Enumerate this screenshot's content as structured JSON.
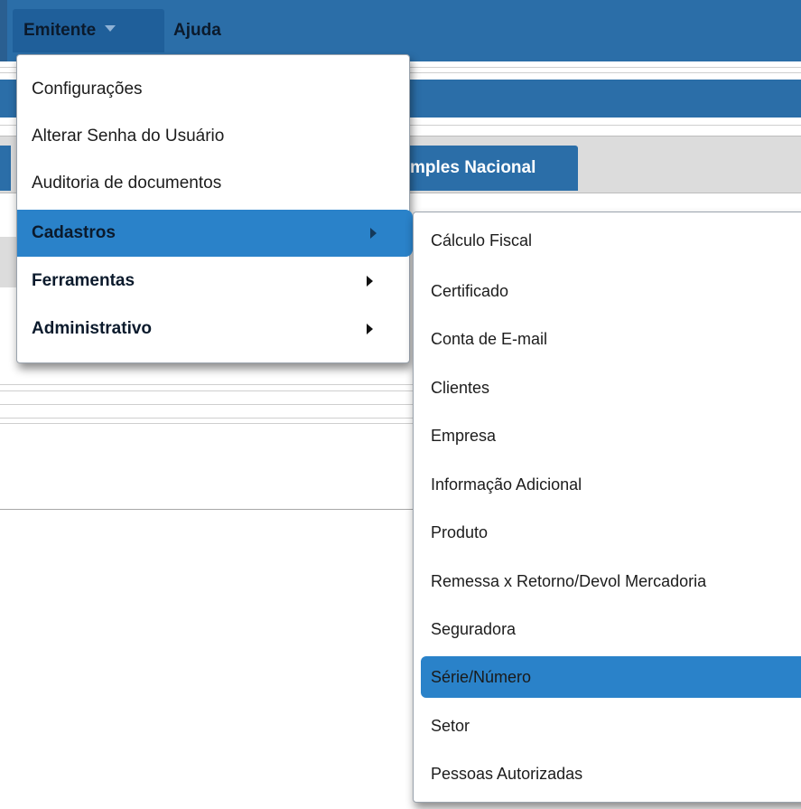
{
  "menubar": {
    "emitente_label": "Emitente",
    "ajuda_label": "Ajuda"
  },
  "background": {
    "tab_label": "mples Nacional"
  },
  "emitente_menu": {
    "items": [
      {
        "label": "Configurações"
      },
      {
        "label": "Alterar Senha do Usuário"
      },
      {
        "label": "Auditoria de documentos"
      },
      {
        "label": "Cadastros"
      },
      {
        "label": "Ferramentas"
      },
      {
        "label": "Administrativo"
      }
    ]
  },
  "cadastros_submenu": {
    "items": [
      {
        "label": "Cálculo Fiscal"
      },
      {
        "label": "Certificado"
      },
      {
        "label": "Conta de E-mail"
      },
      {
        "label": "Clientes"
      },
      {
        "label": "Empresa"
      },
      {
        "label": "Informação Adicional"
      },
      {
        "label": "Produto"
      },
      {
        "label": "Remessa x Retorno/Devol Mercadoria"
      },
      {
        "label": "Seguradora"
      },
      {
        "label": "Série/Número"
      },
      {
        "label": "Setor"
      },
      {
        "label": "Pessoas Autorizadas"
      }
    ]
  },
  "colors": {
    "topbar": "#2b6ea8",
    "highlight": "#2a82c9",
    "menu_bg": "#ffffff"
  },
  "icons": [
    "chevron-down-icon",
    "chevron-right-icon"
  ]
}
